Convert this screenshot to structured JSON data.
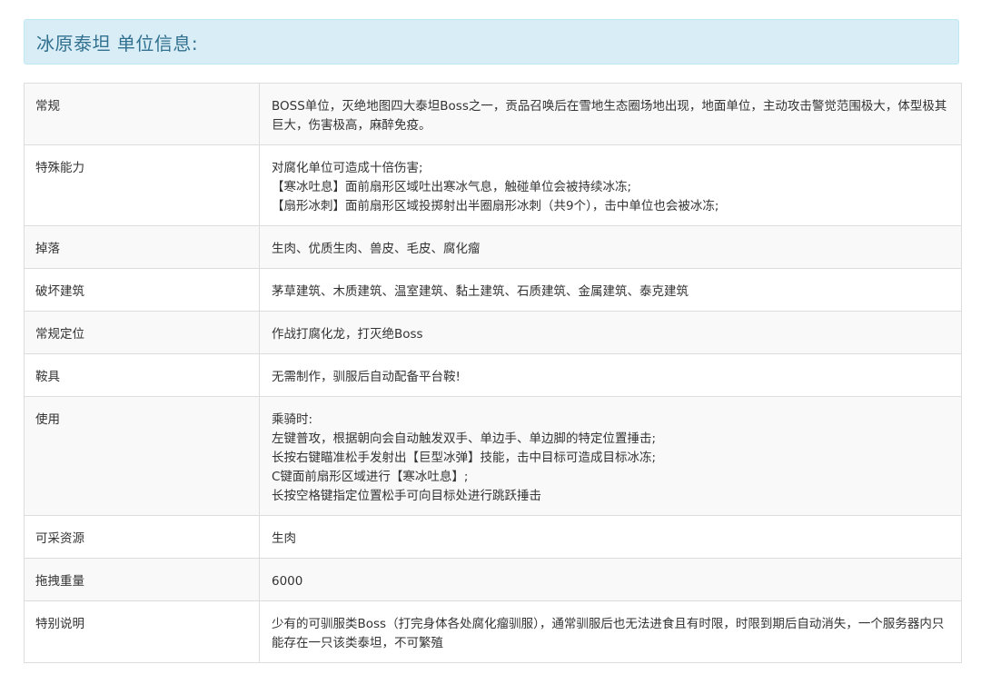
{
  "header": {
    "title": "冰原泰坦 单位信息:"
  },
  "rows": [
    {
      "label": "常规",
      "lines": [
        "BOSS单位，灭绝地图四大泰坦Boss之一，贡品召唤后在雪地生态圈场地出现，地面单位，主动攻击警觉范围极大，体型极其巨大，伤害极高，麻醉免疫。"
      ]
    },
    {
      "label": "特殊能力",
      "lines": [
        "对腐化单位可造成十倍伤害;",
        "【寒冰吐息】面前扇形区域吐出寒冰气息，触碰单位会被持续冰冻;",
        "【扇形冰刺】面前扇形区域投掷射出半圈扇形冰刺（共9个），击中单位也会被冰冻;"
      ]
    },
    {
      "label": "掉落",
      "lines": [
        "生肉、优质生肉、兽皮、毛皮、腐化瘤"
      ]
    },
    {
      "label": "破坏建筑",
      "lines": [
        "茅草建筑、木质建筑、温室建筑、黏土建筑、石质建筑、金属建筑、泰克建筑"
      ]
    },
    {
      "label": "常规定位",
      "lines": [
        "作战打腐化龙，打灭绝Boss"
      ]
    },
    {
      "label": "鞍具",
      "lines": [
        "无需制作，驯服后自动配备平台鞍!"
      ]
    },
    {
      "label": "使用",
      "lines": [
        "乘骑时:",
        "左键普攻，根据朝向会自动触发双手、单边手、单边脚的特定位置捶击;",
        "长按右键瞄准松手发射出【巨型冰弹】技能，击中目标可造成目标冰冻;",
        "C键面前扇形区域进行【寒冰吐息】;",
        "长按空格键指定位置松手可向目标处进行跳跃捶击"
      ]
    },
    {
      "label": "可采资源",
      "lines": [
        "生肉"
      ]
    },
    {
      "label": "拖拽重量",
      "lines": [
        "6000"
      ]
    },
    {
      "label": "特别说明",
      "lines": [
        "少有的可驯服类Boss（打完身体各处腐化瘤驯服），通常驯服后也无法进食且有时限，时限到期后自动消失，一个服务器内只能存在一只该类泰坦，不可繁殖"
      ]
    }
  ]
}
